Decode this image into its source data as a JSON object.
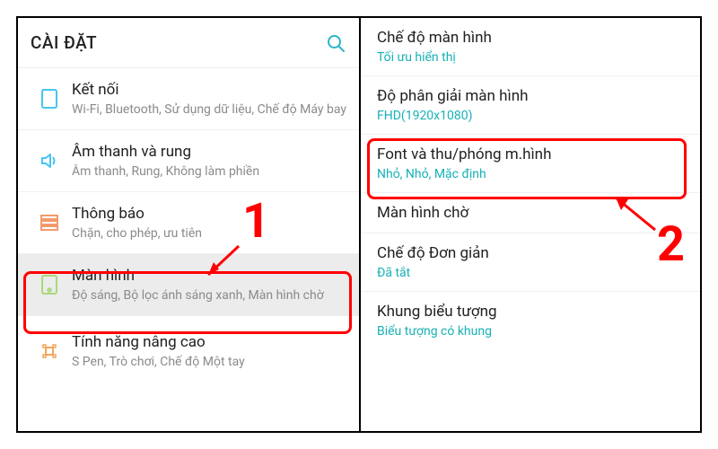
{
  "header": {
    "title": "CÀI ĐẶT"
  },
  "left_items": [
    {
      "title": "Kết nối",
      "sub": "Wi-Fi, Bluetooth, Sử dụng dữ liệu, Chế độ Máy bay"
    },
    {
      "title": "Âm thanh và rung",
      "sub": "Âm thanh, Rung, Không làm phiền"
    },
    {
      "title": "Thông báo",
      "sub": "Chặn, cho phép, ưu tiên"
    },
    {
      "title": "Màn hình",
      "sub": "Độ sáng, Bộ lọc ánh sáng xanh, Màn hình chờ"
    },
    {
      "title": "Tính năng nâng cao",
      "sub": "S Pen, Trò chơi, Chế độ Một tay"
    }
  ],
  "right_items": [
    {
      "title": "Chế độ màn hình",
      "sub": "Tối ưu hiển thị"
    },
    {
      "title": "Độ phân giải màn hình",
      "sub": "FHD(1920x1080)"
    },
    {
      "title": "Font và thu/phóng m.hình",
      "sub": "Nhỏ, Nhỏ, Mặc định"
    },
    {
      "title": "Màn hình chờ",
      "sub": ""
    },
    {
      "title": "Chế độ Đơn giản",
      "sub": "Đã tắt"
    },
    {
      "title": "Khung biểu tượng",
      "sub": "Biểu tượng có khung"
    }
  ],
  "annotations": {
    "num1": "1",
    "num2": "2"
  },
  "colors": {
    "icon_conn": "#46c5f0",
    "icon_sound": "#46c5f0",
    "icon_notif": "#f29b6c",
    "icon_display": "#a7d97a",
    "icon_adv": "#f2a65a",
    "search": "#2bb6c8"
  }
}
